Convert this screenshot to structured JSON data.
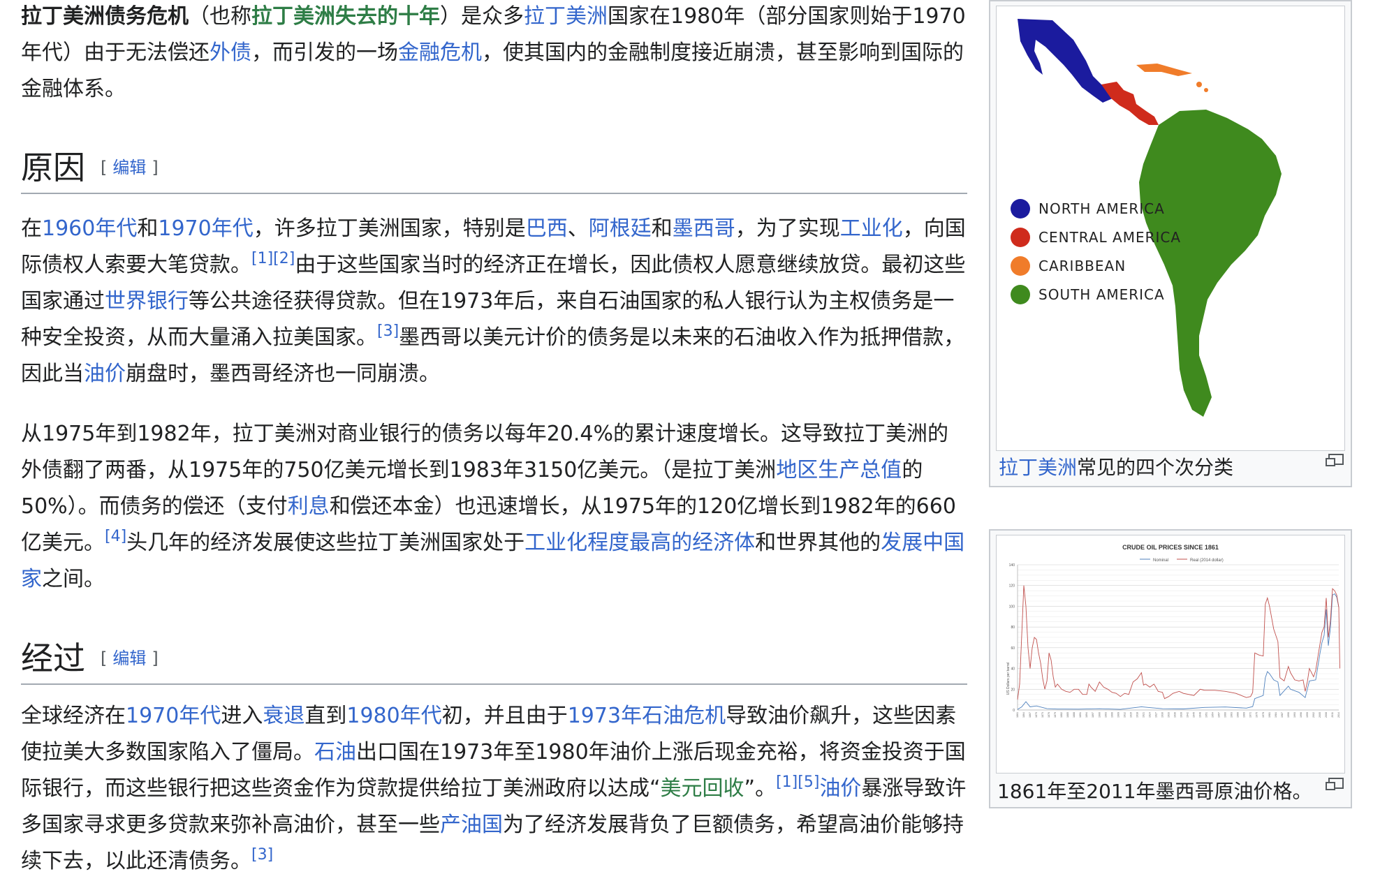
{
  "intro": {
    "title_bold": "拉丁美洲债务危机",
    "t1": "（也称",
    "link_lost_decade": "拉丁美洲失去的十年",
    "t2": "）是众多",
    "link_latin_america": "拉丁美洲",
    "t3": "国家在1980年（部分国家则始于1970年代）由于无法偿还",
    "link_foreign_debt": "外债",
    "t4": "，而引发的一场",
    "link_financial_crisis": "金融危机",
    "t5": "，使其国内的金融制度接近崩溃，甚至影响到国际的金融体系。"
  },
  "section_causes": {
    "heading": "原因",
    "edit_open": "[",
    "edit_label": "编辑",
    "edit_close": "]",
    "p1": {
      "t0": "在",
      "l_1960s": "1960年代",
      "t1": "和",
      "l_1970s": "1970年代",
      "t2": "，许多拉丁美洲国家，特别是",
      "l_brazil": "巴西",
      "t3": "、",
      "l_argentina": "阿根廷",
      "t4": "和",
      "l_mexico": "墨西哥",
      "t5": "，为了实现",
      "l_industrialization": "工业化",
      "t6": "，向国际债权人索要大笔贷款。",
      "ref_1": "[1]",
      "ref_2": "[2]",
      "t7": "由于这些国家当时的经济正在增长，因此债权人愿意继续放贷。最初这些国家通过",
      "l_world_bank": "世界银行",
      "t8": "等公共途径获得贷款。但在1973年后，来自石油国家的私人银行认为主权债务是一种安全投资，从而大量涌入拉美国家。",
      "ref_3": "[3]",
      "t9": "墨西哥以美元计价的债务是以未来的石油收入作为抵押借款，因此当",
      "l_oil_price": "油价",
      "t10": "崩盘时，墨西哥经济也一同崩溃。"
    },
    "p2": {
      "t0": "从1975年到1982年，拉丁美洲对商业银行的债务以每年20.4%的累计速度增长。这导致拉丁美洲的外债翻了两番，从1975年的750亿美元增长到1983年3150亿美元。（是拉丁美洲",
      "l_gdp": "地区生产总值",
      "t1": "的50%）。而债务的偿还（支付",
      "l_interest": "利息",
      "t2": "和偿还本金）也迅速增长，从1975年的120亿增长到1982年的660亿美元。",
      "ref_4": "[4]",
      "t3": "头几年的经济发展使这些拉丁美洲国家处于",
      "l_industrialized": "工业化程度最高的经济体",
      "t4": "和世界其他的",
      "l_developing": "发展中国家",
      "t5": "之间。"
    }
  },
  "section_course": {
    "heading": "经过",
    "edit_open": "[",
    "edit_label": "编辑",
    "edit_close": "]",
    "p1": {
      "t0": "全球经济在",
      "l_1970s": "1970年代",
      "t1": "进入",
      "l_recession": "衰退",
      "t2": "直到",
      "l_1980s": "1980年代",
      "t3": "初，并且由于",
      "l_oil_crisis": "1973年石油危机",
      "t4": "导致油价飙升，这些因素使拉美大多数国家陷入了僵局。",
      "l_petroleum": "石油",
      "t5": "出口国在1973年至1980年油价上涨后现金充裕，将资金投资于国际银行，而这些银行把这些资金作为贷款提供给拉丁美洲政府以达成“",
      "l_recycling": "美元回收",
      "t6": "”。",
      "ref_1": "[1]",
      "ref_5": "[5]",
      "l_oil_price": "油价",
      "t7": "暴涨导致许多国家寻求更多贷款来弥补高油价，甚至一些",
      "l_producers": "产油国",
      "t8": "为了经济发展背负了巨额债务，希望高油价能够持续下去，以此还清债务。",
      "ref_3": "[3]"
    }
  },
  "map_figure": {
    "legend": [
      {
        "label": "NORTH AMERICA",
        "color": "#1b1b9e"
      },
      {
        "label": "CENTRAL AMERICA",
        "color": "#cf2b1c"
      },
      {
        "label": "CARIBBEAN",
        "color": "#f07c2a"
      },
      {
        "label": "SOUTH AMERICA",
        "color": "#3f8a1e"
      }
    ],
    "caption_link": "拉丁美洲",
    "caption_text": "常见的四个次分类"
  },
  "oil_figure": {
    "caption": "1861年至2011年墨西哥原油价格。",
    "chart_data": {
      "type": "line",
      "title": "CRUDE OIL PRICES SINCE 1861",
      "ylabel": "US Dollars per barrel",
      "ylim": [
        0,
        140
      ],
      "yticks": [
        0,
        20,
        40,
        60,
        80,
        100,
        120,
        140
      ],
      "xlim": [
        1861,
        2014
      ],
      "series": [
        {
          "name": "Nominal",
          "color": "#4f81bd",
          "points": [
            [
              1861,
              0.5
            ],
            [
              1863,
              3
            ],
            [
              1865,
              8
            ],
            [
              1867,
              3
            ],
            [
              1870,
              3.9
            ],
            [
              1875,
              1.3
            ],
            [
              1880,
              0.9
            ],
            [
              1890,
              0.8
            ],
            [
              1900,
              1.2
            ],
            [
              1910,
              0.6
            ],
            [
              1920,
              3.1
            ],
            [
              1930,
              1.2
            ],
            [
              1940,
              1.0
            ],
            [
              1950,
              2.5
            ],
            [
              1960,
              2.9
            ],
            [
              1970,
              1.8
            ],
            [
              1973,
              3.3
            ],
            [
              1974,
              11
            ],
            [
              1978,
              14
            ],
            [
              1979,
              31
            ],
            [
              1980,
              37
            ],
            [
              1981,
              35
            ],
            [
              1983,
              29
            ],
            [
              1985,
              27
            ],
            [
              1986,
              14
            ],
            [
              1990,
              23
            ],
            [
              1991,
              20
            ],
            [
              1995,
              17
            ],
            [
              1998,
              12
            ],
            [
              2000,
              28
            ],
            [
              2003,
              29
            ],
            [
              2005,
              54
            ],
            [
              2006,
              65
            ],
            [
              2007,
              72
            ],
            [
              2008,
              97
            ],
            [
              2009,
              62
            ],
            [
              2010,
              79
            ],
            [
              2011,
              111
            ],
            [
              2012,
              112
            ],
            [
              2013,
              109
            ],
            [
              2014,
              99
            ]
          ]
        },
        {
          "name": "Real (2014 dollar)",
          "color": "#c0504d",
          "points": [
            [
              1861,
              10
            ],
            [
              1862,
              25
            ],
            [
              1864,
              120
            ],
            [
              1865,
              100
            ],
            [
              1866,
              60
            ],
            [
              1867,
              40
            ],
            [
              1868,
              60
            ],
            [
              1869,
              70
            ],
            [
              1870,
              68
            ],
            [
              1871,
              55
            ],
            [
              1872,
              45
            ],
            [
              1873,
              30
            ],
            [
              1874,
              20
            ],
            [
              1875,
              28
            ],
            [
              1876,
              55
            ],
            [
              1877,
              48
            ],
            [
              1878,
              32
            ],
            [
              1879,
              22
            ],
            [
              1880,
              25
            ],
            [
              1882,
              20
            ],
            [
              1884,
              18
            ],
            [
              1886,
              17
            ],
            [
              1888,
              20
            ],
            [
              1890,
              20
            ],
            [
              1892,
              15
            ],
            [
              1894,
              15
            ],
            [
              1895,
              25
            ],
            [
              1896,
              22
            ],
            [
              1898,
              18
            ],
            [
              1900,
              27
            ],
            [
              1902,
              22
            ],
            [
              1904,
              20
            ],
            [
              1906,
              17
            ],
            [
              1908,
              16
            ],
            [
              1910,
              13
            ],
            [
              1912,
              16
            ],
            [
              1914,
              15
            ],
            [
              1916,
              27
            ],
            [
              1918,
              30
            ],
            [
              1920,
              36
            ],
            [
              1921,
              24
            ],
            [
              1922,
              25
            ],
            [
              1924,
              22
            ],
            [
              1926,
              25
            ],
            [
              1928,
              18
            ],
            [
              1930,
              17
            ],
            [
              1931,
              11
            ],
            [
              1933,
              13
            ],
            [
              1935,
              16
            ],
            [
              1938,
              18
            ],
            [
              1940,
              16
            ],
            [
              1945,
              14
            ],
            [
              1948,
              20
            ],
            [
              1950,
              19
            ],
            [
              1955,
              19
            ],
            [
              1960,
              18
            ],
            [
              1965,
              16
            ],
            [
              1970,
              12
            ],
            [
              1972,
              13
            ],
            [
              1973,
              17
            ],
            [
              1974,
              55
            ],
            [
              1976,
              53
            ],
            [
              1978,
              52
            ],
            [
              1979,
              102
            ],
            [
              1980,
              108
            ],
            [
              1981,
              100
            ],
            [
              1983,
              78
            ],
            [
              1985,
              66
            ],
            [
              1986,
              31
            ],
            [
              1988,
              28
            ],
            [
              1990,
              42
            ],
            [
              1991,
              36
            ],
            [
              1993,
              29
            ],
            [
              1995,
              28
            ],
            [
              1997,
              29
            ],
            [
              1998,
              18
            ],
            [
              1999,
              27
            ],
            [
              2000,
              40
            ],
            [
              2002,
              32
            ],
            [
              2003,
              38
            ],
            [
              2005,
              63
            ],
            [
              2006,
              75
            ],
            [
              2007,
              80
            ],
            [
              2008,
              108
            ],
            [
              2009,
              70
            ],
            [
              2010,
              86
            ],
            [
              2011,
              117
            ],
            [
              2012,
              115
            ],
            [
              2013,
              111
            ],
            [
              2014,
              99
            ],
            [
              2014.5,
              40
            ]
          ]
        }
      ]
    }
  }
}
